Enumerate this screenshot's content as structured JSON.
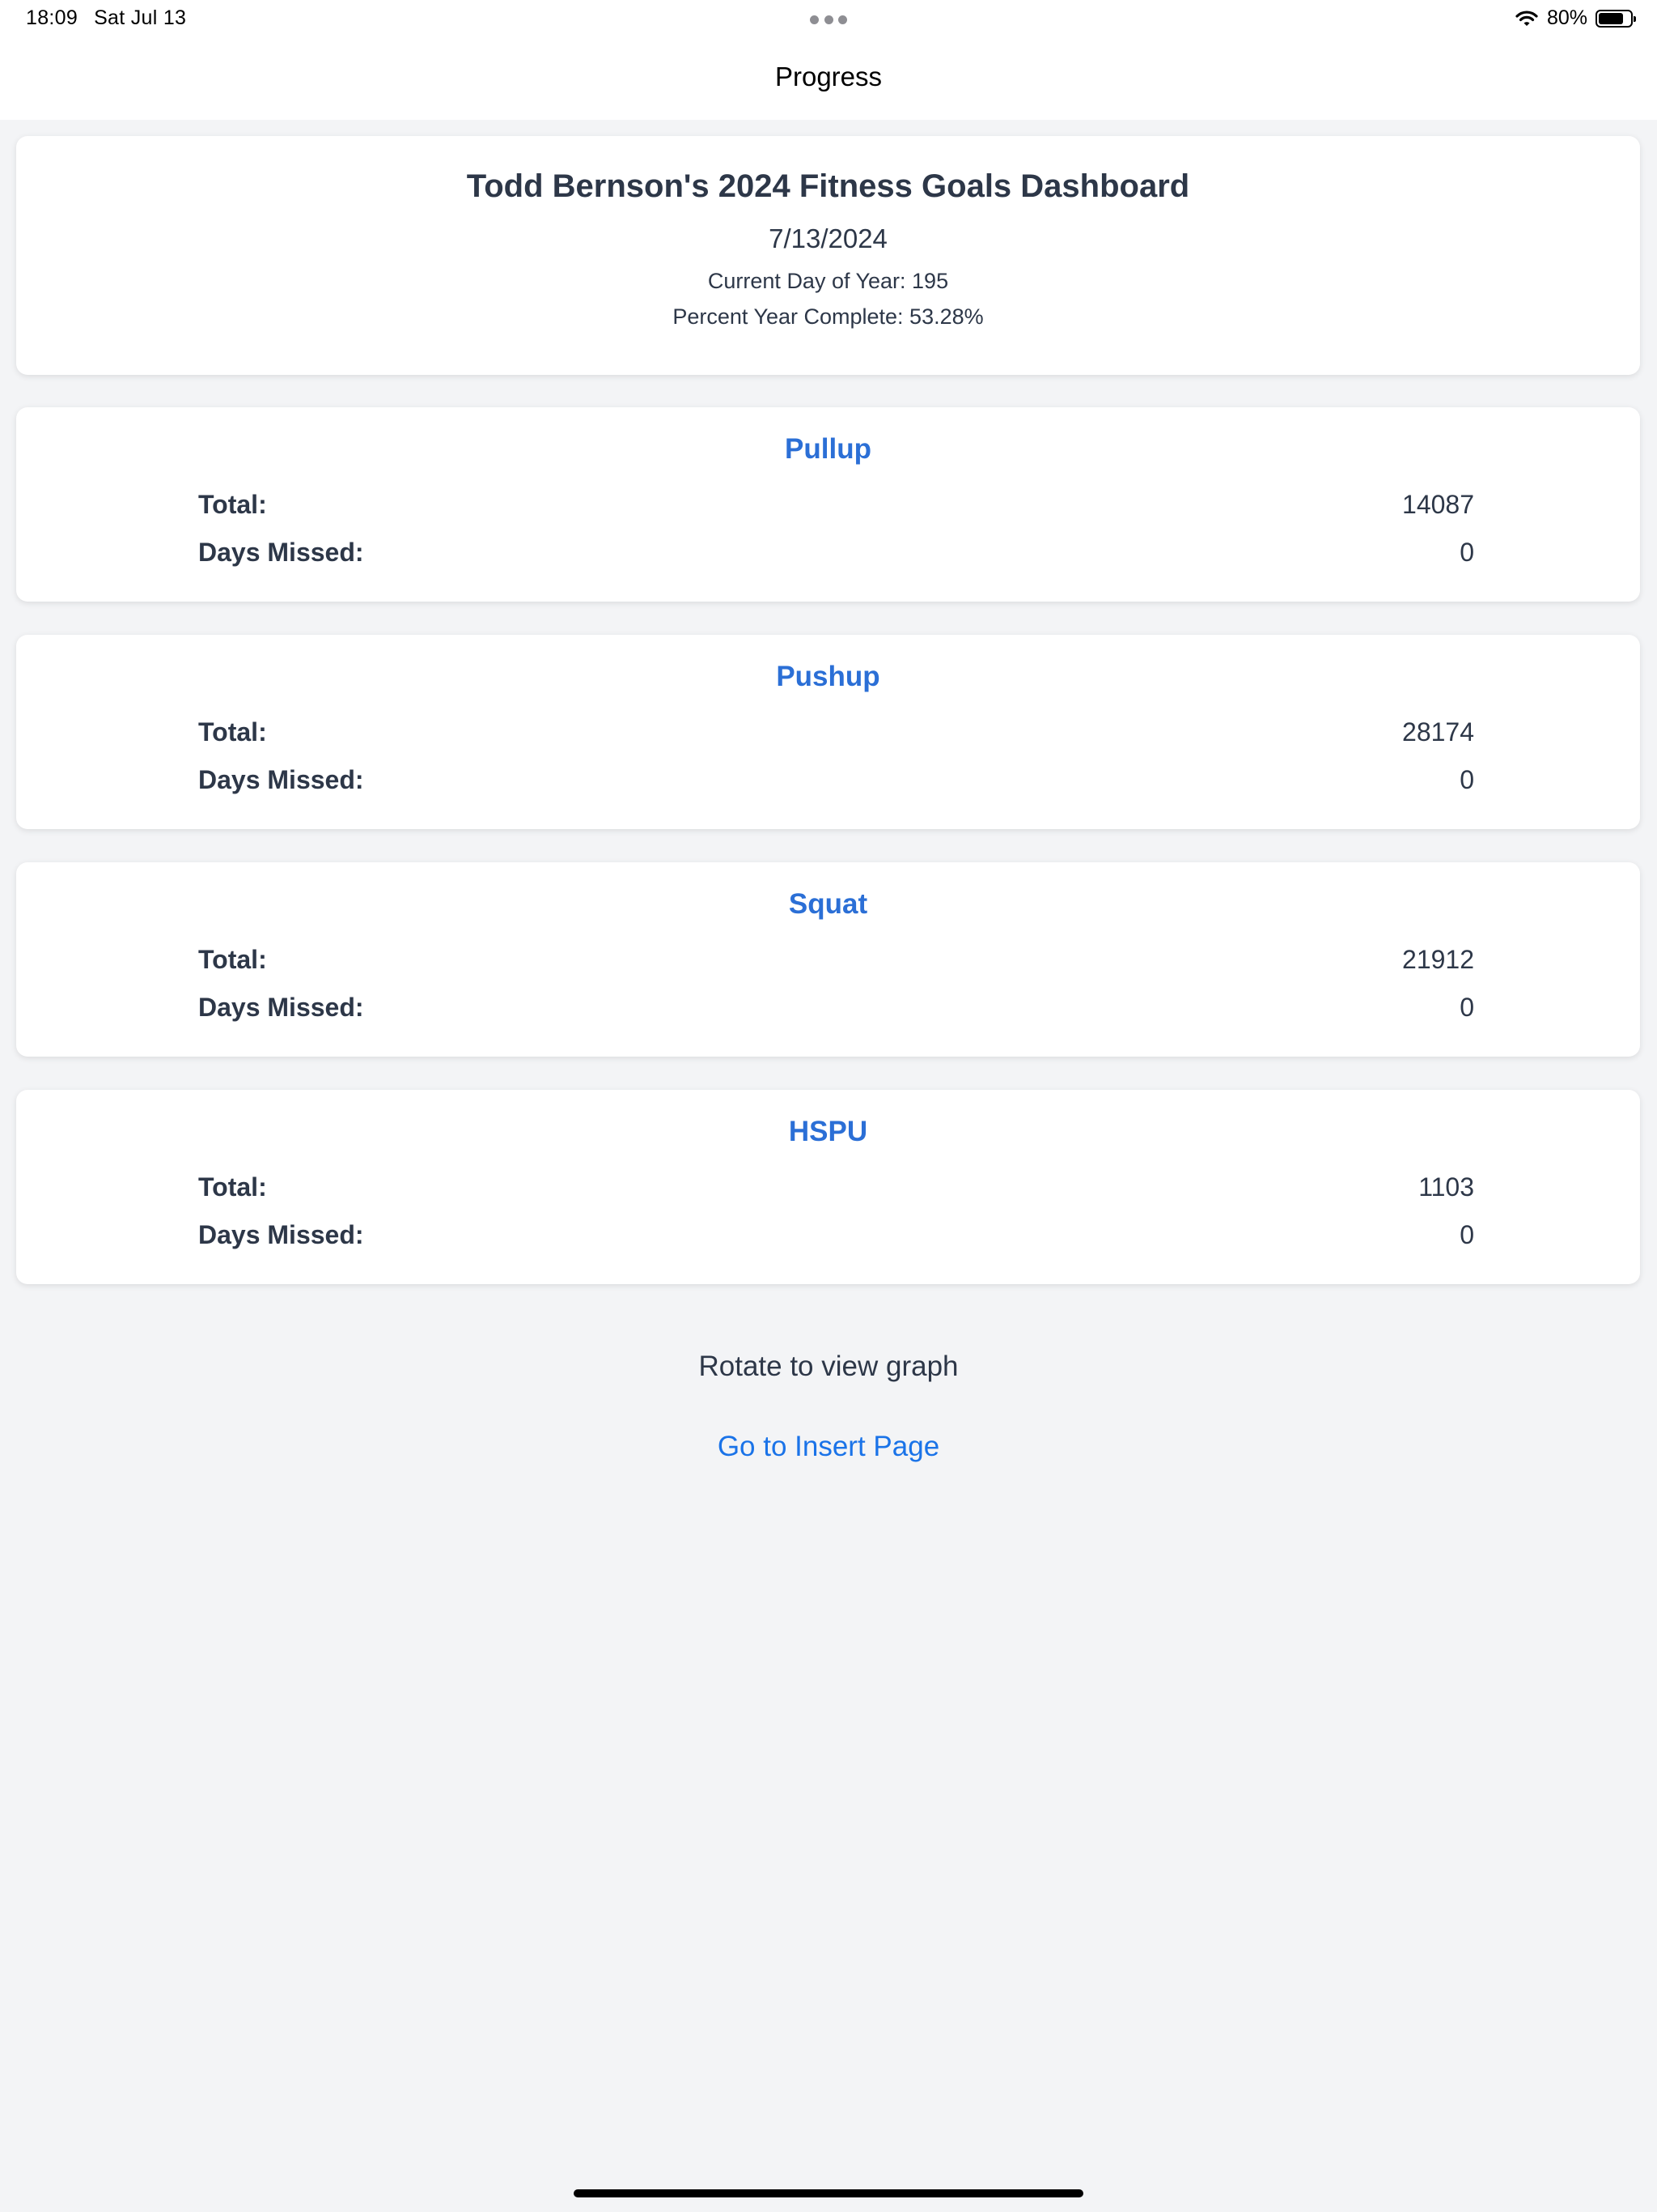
{
  "status_bar": {
    "time": "18:09",
    "date": "Sat Jul 13",
    "battery": "80%",
    "battery_level": 0.8
  },
  "nav": {
    "title": "Progress"
  },
  "dashboard": {
    "title": "Todd Bernson's 2024 Fitness Goals Dashboard",
    "date": "7/13/2024",
    "day_of_year": "Current Day of Year: 195",
    "percent_complete": "Percent Year Complete: 53.28%"
  },
  "labels": {
    "total": "Total:",
    "days_missed": "Days Missed:"
  },
  "exercises": [
    {
      "name": "Pullup",
      "total": "14087",
      "days_missed": "0"
    },
    {
      "name": "Pushup",
      "total": "28174",
      "days_missed": "0"
    },
    {
      "name": "Squat",
      "total": "21912",
      "days_missed": "0"
    },
    {
      "name": "HSPU",
      "total": "1103",
      "days_missed": "0"
    }
  ],
  "footer": {
    "rotate_hint": "Rotate to view graph",
    "insert_link": "Go to Insert Page"
  },
  "colors": {
    "accent": "#2b6fd6",
    "link": "#1a73e8",
    "background": "#f3f4f6"
  }
}
